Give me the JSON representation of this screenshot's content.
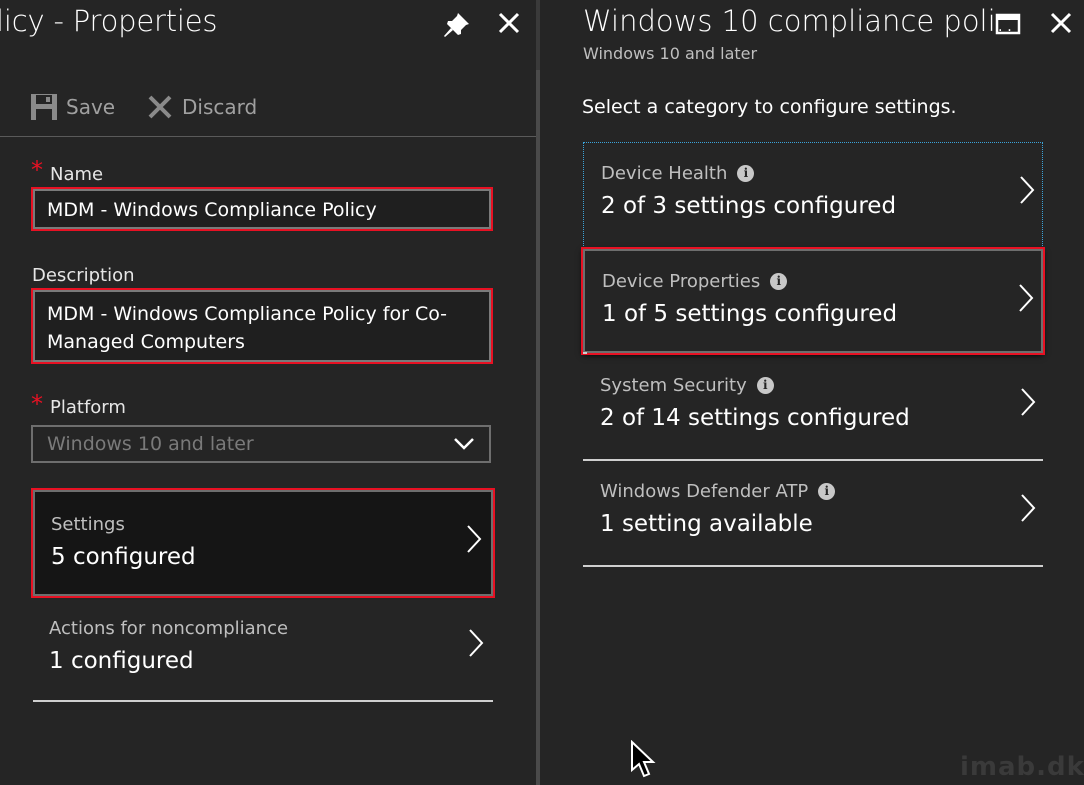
{
  "left_blade": {
    "title": "licy - Properties",
    "toolbar": {
      "save_label": "Save",
      "discard_label": "Discard"
    },
    "name": {
      "label": "Name",
      "value": "MDM - Windows Compliance Policy",
      "required": true
    },
    "description": {
      "label": "Description",
      "value": "MDM - Windows Compliance Policy for Co-Managed Computers"
    },
    "platform": {
      "label": "Platform",
      "selected": "Windows 10 and later",
      "required": true
    },
    "settings": {
      "title": "Settings",
      "summary": "5 configured"
    },
    "actions": {
      "title": "Actions for noncompliance",
      "summary": "1 configured"
    }
  },
  "right_blade": {
    "title": "Windows 10 compliance poli...",
    "subtitle": "Windows 10 and later",
    "instruction": "Select a category to configure settings.",
    "categories": [
      {
        "title": "Device Health",
        "summary": "2 of 3 settings configured"
      },
      {
        "title": "Device Properties",
        "summary": "1 of 5 settings configured"
      },
      {
        "title": "System Security",
        "summary": "2 of 14 settings configured"
      },
      {
        "title": "Windows Defender ATP",
        "summary": "1 setting available"
      }
    ]
  },
  "watermark": "imab.dk",
  "colors": {
    "background": "#252525",
    "highlight": "#e81123",
    "accent_dotted": "#3ba3d9"
  },
  "icons": [
    "pin-icon",
    "close-icon",
    "save-icon",
    "discard-icon",
    "chevron-down-icon",
    "chevron-right-icon",
    "info-icon",
    "maximize-icon",
    "mouse-cursor-icon"
  ]
}
